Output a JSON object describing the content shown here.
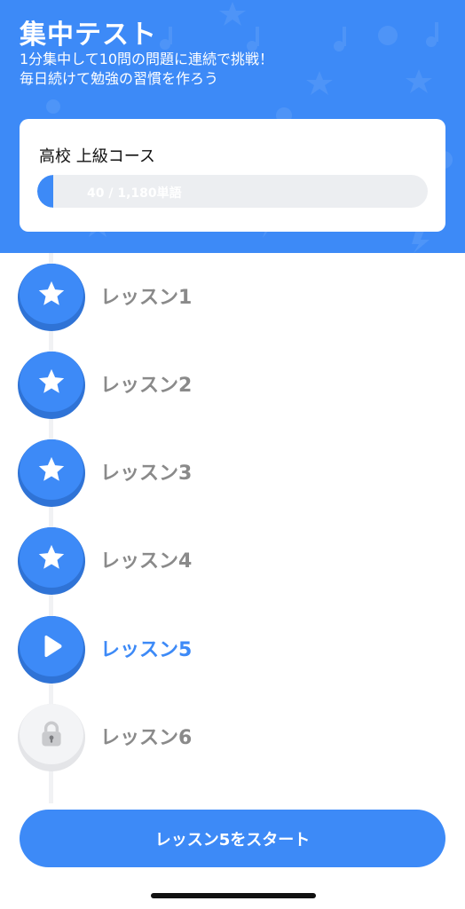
{
  "header": {
    "title": "集中テスト",
    "subtitle_line1": "1分集中して10問の問題に連続で挑戦！",
    "subtitle_line2": "毎日続けて勉強の習慣を作ろう"
  },
  "course": {
    "name": "高校 上級コース",
    "progress_text": "40 / 1,180単語",
    "progress_fraction": 0.034
  },
  "lessons": [
    {
      "label": "レッスン1",
      "state": "done",
      "icon": "star-icon"
    },
    {
      "label": "レッスン2",
      "state": "done",
      "icon": "star-icon"
    },
    {
      "label": "レッスン3",
      "state": "done",
      "icon": "star-icon"
    },
    {
      "label": "レッスン4",
      "state": "done",
      "icon": "star-icon"
    },
    {
      "label": "レッスン5",
      "state": "current",
      "icon": "play-icon"
    },
    {
      "label": "レッスン6",
      "state": "locked",
      "icon": "lock-icon"
    }
  ],
  "start_button": {
    "label": "レッスン5をスタート"
  },
  "colors": {
    "accent": "#3d8af7",
    "accent_dark": "#2f73d6",
    "muted_text": "#8a8a8a"
  }
}
